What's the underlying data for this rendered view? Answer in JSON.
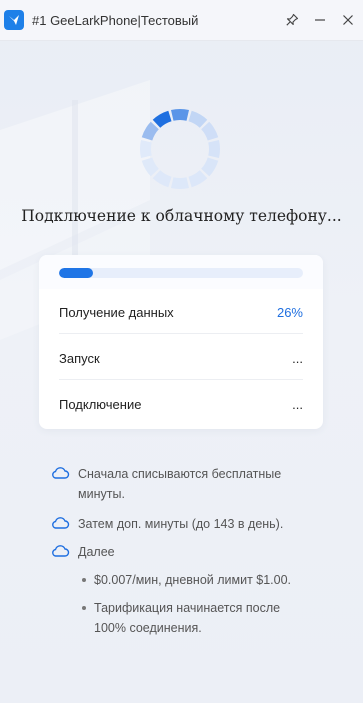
{
  "window": {
    "title": "#1 GeeLarkPhone|Тестовый"
  },
  "icons": {
    "app": "geelark-logo-icon",
    "pin": "pin-icon",
    "minimize": "minimize-icon",
    "close": "close-icon",
    "spinner": "loading-spinner-icon",
    "note": "cloud-icon"
  },
  "colors": {
    "accent": "#1f75e6",
    "accent_light": "#e7eefb"
  },
  "status": {
    "message": "Подключение к облачному телефону..."
  },
  "progress": {
    "percent": 14
  },
  "steps": [
    {
      "label": "Получение данных",
      "value": "26%"
    },
    {
      "label": "Запуск",
      "value": "..."
    },
    {
      "label": "Подключение",
      "value": "..."
    }
  ],
  "notes": {
    "items": [
      "Сначала списываются бесплатные минуты.",
      "Затем доп. минуты (до 143 в день).",
      "Далее"
    ],
    "sub_items": [
      "$0.007/мин, дневной лимит $1.00.",
      "Тарификация начинается после 100% соединения."
    ]
  }
}
